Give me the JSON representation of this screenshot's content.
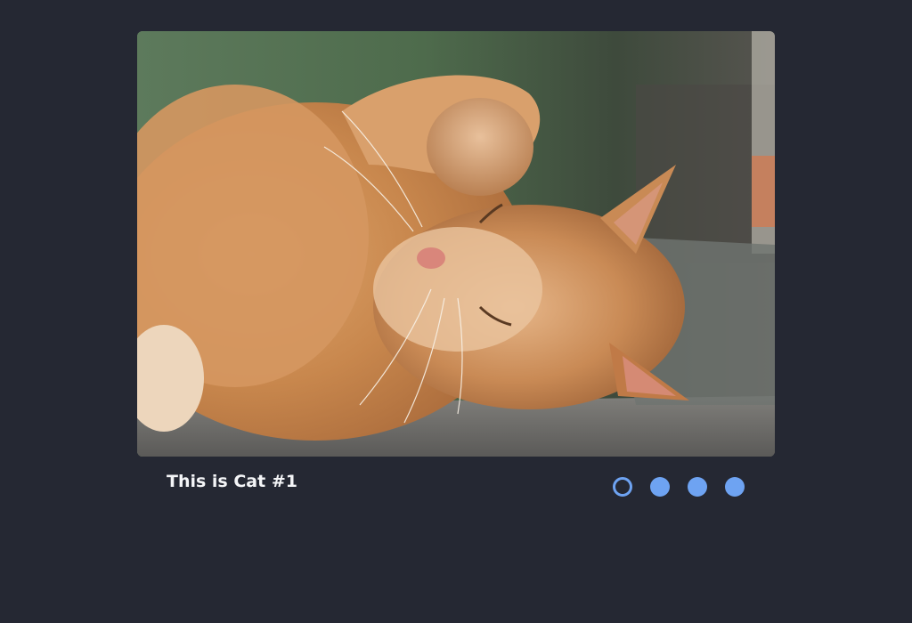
{
  "carousel": {
    "caption": "This is Cat #1",
    "active_index": 0,
    "slides": [
      {
        "image": "sleeping-orange-cat-photo"
      },
      {
        "image": "cat-photo-2"
      },
      {
        "image": "cat-photo-3"
      },
      {
        "image": "cat-photo-4"
      }
    ]
  },
  "colors": {
    "background": "#252833",
    "accent": "#6ea3f2",
    "caption_text": "#f4f5f7"
  }
}
